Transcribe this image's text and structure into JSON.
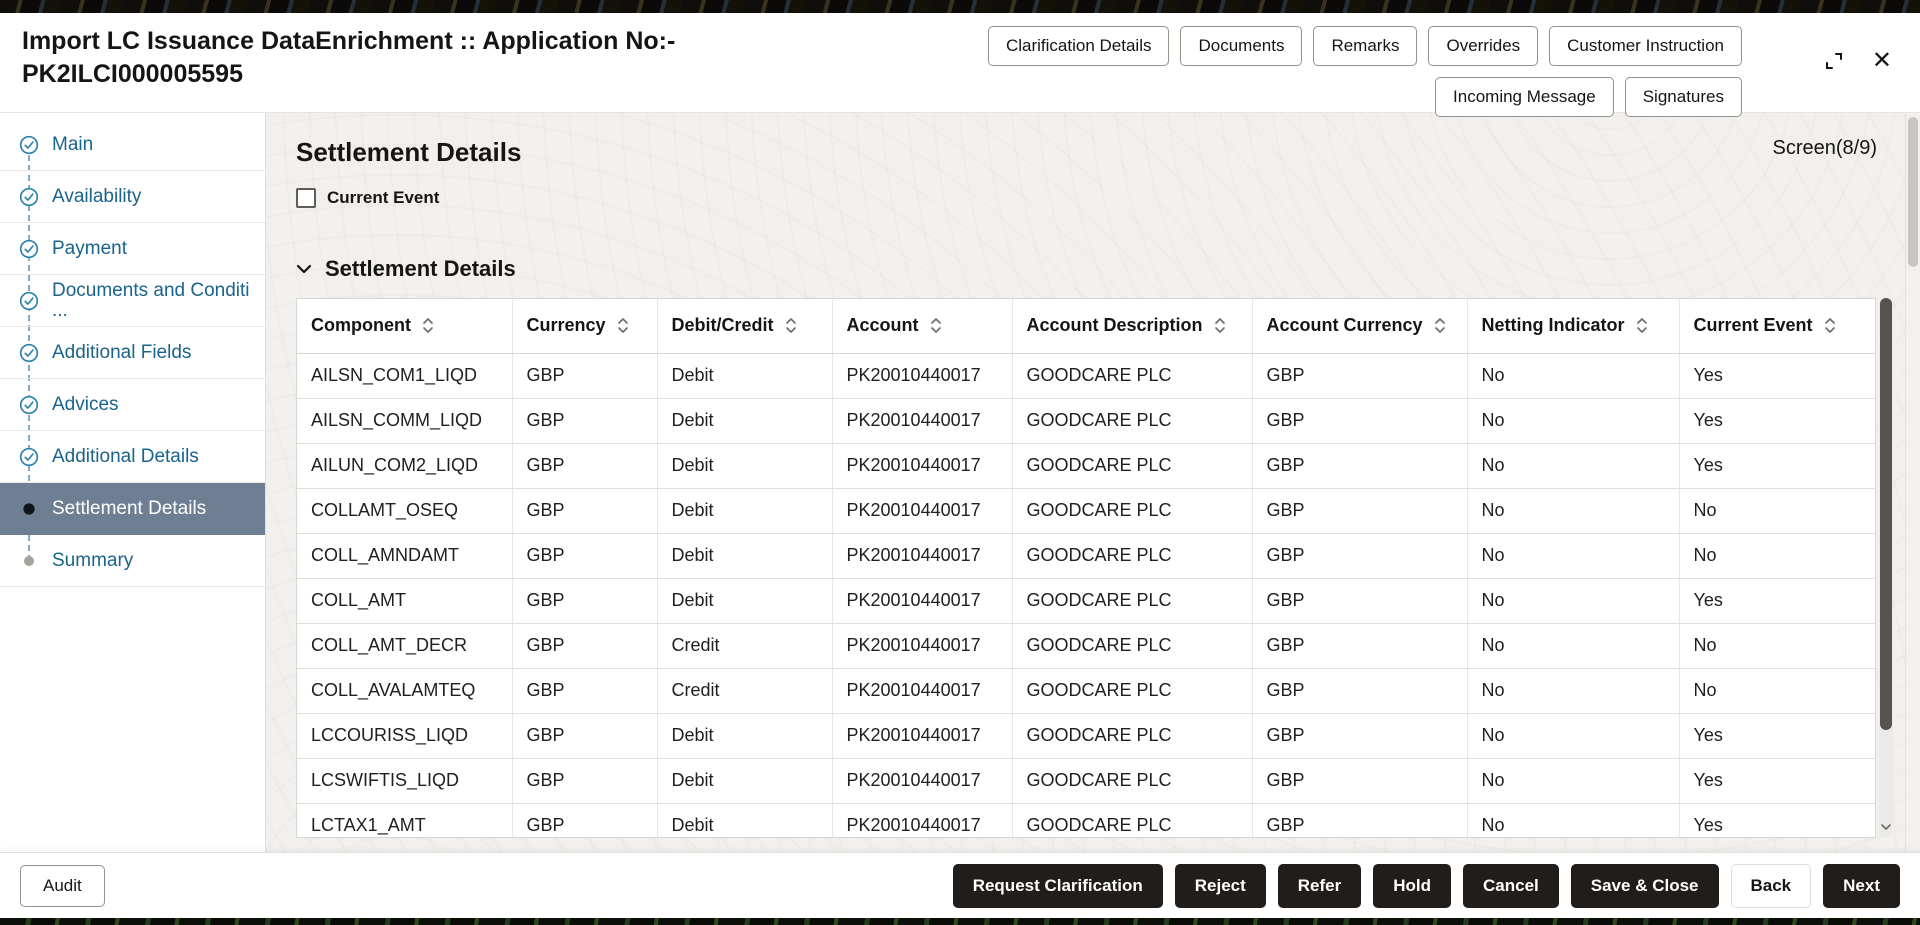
{
  "window": {
    "title_line1": "Import LC Issuance DataEnrichment :: Application No:-",
    "title_line2": "PK2ILCI000005595",
    "header_buttons_row1": [
      "Clarification Details",
      "Documents",
      "Remarks",
      "Overrides",
      "Customer Instruction"
    ],
    "header_buttons_row2": [
      "Incoming Message",
      "Signatures"
    ]
  },
  "icons": {
    "close": "✕"
  },
  "sidebar": {
    "items": [
      {
        "label": "Main",
        "state": "done"
      },
      {
        "label": "Availability",
        "state": "done"
      },
      {
        "label": "Payment",
        "state": "done"
      },
      {
        "label": "Documents and Conditi ...",
        "state": "done"
      },
      {
        "label": "Additional Fields",
        "state": "done"
      },
      {
        "label": "Advices",
        "state": "done"
      },
      {
        "label": "Additional Details",
        "state": "done"
      },
      {
        "label": "Settlement Details",
        "state": "active"
      },
      {
        "label": "Summary",
        "state": "pending"
      }
    ]
  },
  "main": {
    "page_title": "Settlement Details",
    "screen_indicator": "Screen(8/9)",
    "current_event_label": "Current Event",
    "section_title": "Settlement Details"
  },
  "table": {
    "columns": [
      "Component",
      "Currency",
      "Debit/Credit",
      "Account",
      "Account Description",
      "Account Currency",
      "Netting Indicator",
      "Current Event"
    ],
    "rows": [
      [
        "AILSN_COM1_LIQD",
        "GBP",
        "Debit",
        "PK20010440017",
        "GOODCARE PLC",
        "GBP",
        "No",
        "Yes"
      ],
      [
        "AILSN_COMM_LIQD",
        "GBP",
        "Debit",
        "PK20010440017",
        "GOODCARE PLC",
        "GBP",
        "No",
        "Yes"
      ],
      [
        "AILUN_COM2_LIQD",
        "GBP",
        "Debit",
        "PK20010440017",
        "GOODCARE PLC",
        "GBP",
        "No",
        "Yes"
      ],
      [
        "COLLAMT_OSEQ",
        "GBP",
        "Debit",
        "PK20010440017",
        "GOODCARE PLC",
        "GBP",
        "No",
        "No"
      ],
      [
        "COLL_AMNDAMT",
        "GBP",
        "Debit",
        "PK20010440017",
        "GOODCARE PLC",
        "GBP",
        "No",
        "No"
      ],
      [
        "COLL_AMT",
        "GBP",
        "Debit",
        "PK20010440017",
        "GOODCARE PLC",
        "GBP",
        "No",
        "Yes"
      ],
      [
        "COLL_AMT_DECR",
        "GBP",
        "Credit",
        "PK20010440017",
        "GOODCARE PLC",
        "GBP",
        "No",
        "No"
      ],
      [
        "COLL_AVALAMTEQ",
        "GBP",
        "Credit",
        "PK20010440017",
        "GOODCARE PLC",
        "GBP",
        "No",
        "No"
      ],
      [
        "LCCOURISS_LIQD",
        "GBP",
        "Debit",
        "PK20010440017",
        "GOODCARE PLC",
        "GBP",
        "No",
        "Yes"
      ],
      [
        "LCSWIFTIS_LIQD",
        "GBP",
        "Debit",
        "PK20010440017",
        "GOODCARE PLC",
        "GBP",
        "No",
        "Yes"
      ],
      [
        "LCTAX1_AMT",
        "GBP",
        "Debit",
        "PK20010440017",
        "GOODCARE PLC",
        "GBP",
        "No",
        "Yes"
      ]
    ]
  },
  "footer": {
    "audit_label": "Audit",
    "actions": [
      {
        "label": "Request Clarification",
        "style": "dark"
      },
      {
        "label": "Reject",
        "style": "dark"
      },
      {
        "label": "Refer",
        "style": "dark"
      },
      {
        "label": "Hold",
        "style": "dark"
      },
      {
        "label": "Cancel",
        "style": "dark"
      },
      {
        "label": "Save & Close",
        "style": "dark"
      },
      {
        "label": "Back",
        "style": "light"
      },
      {
        "label": "Next",
        "style": "dark"
      }
    ]
  },
  "colors": {
    "accent_link": "#19648c",
    "step_check": "#2f84ab",
    "active_step_bg": "#6e7f93",
    "dark_button_bg": "#201d1a",
    "content_bg": "#f2f0ee"
  }
}
